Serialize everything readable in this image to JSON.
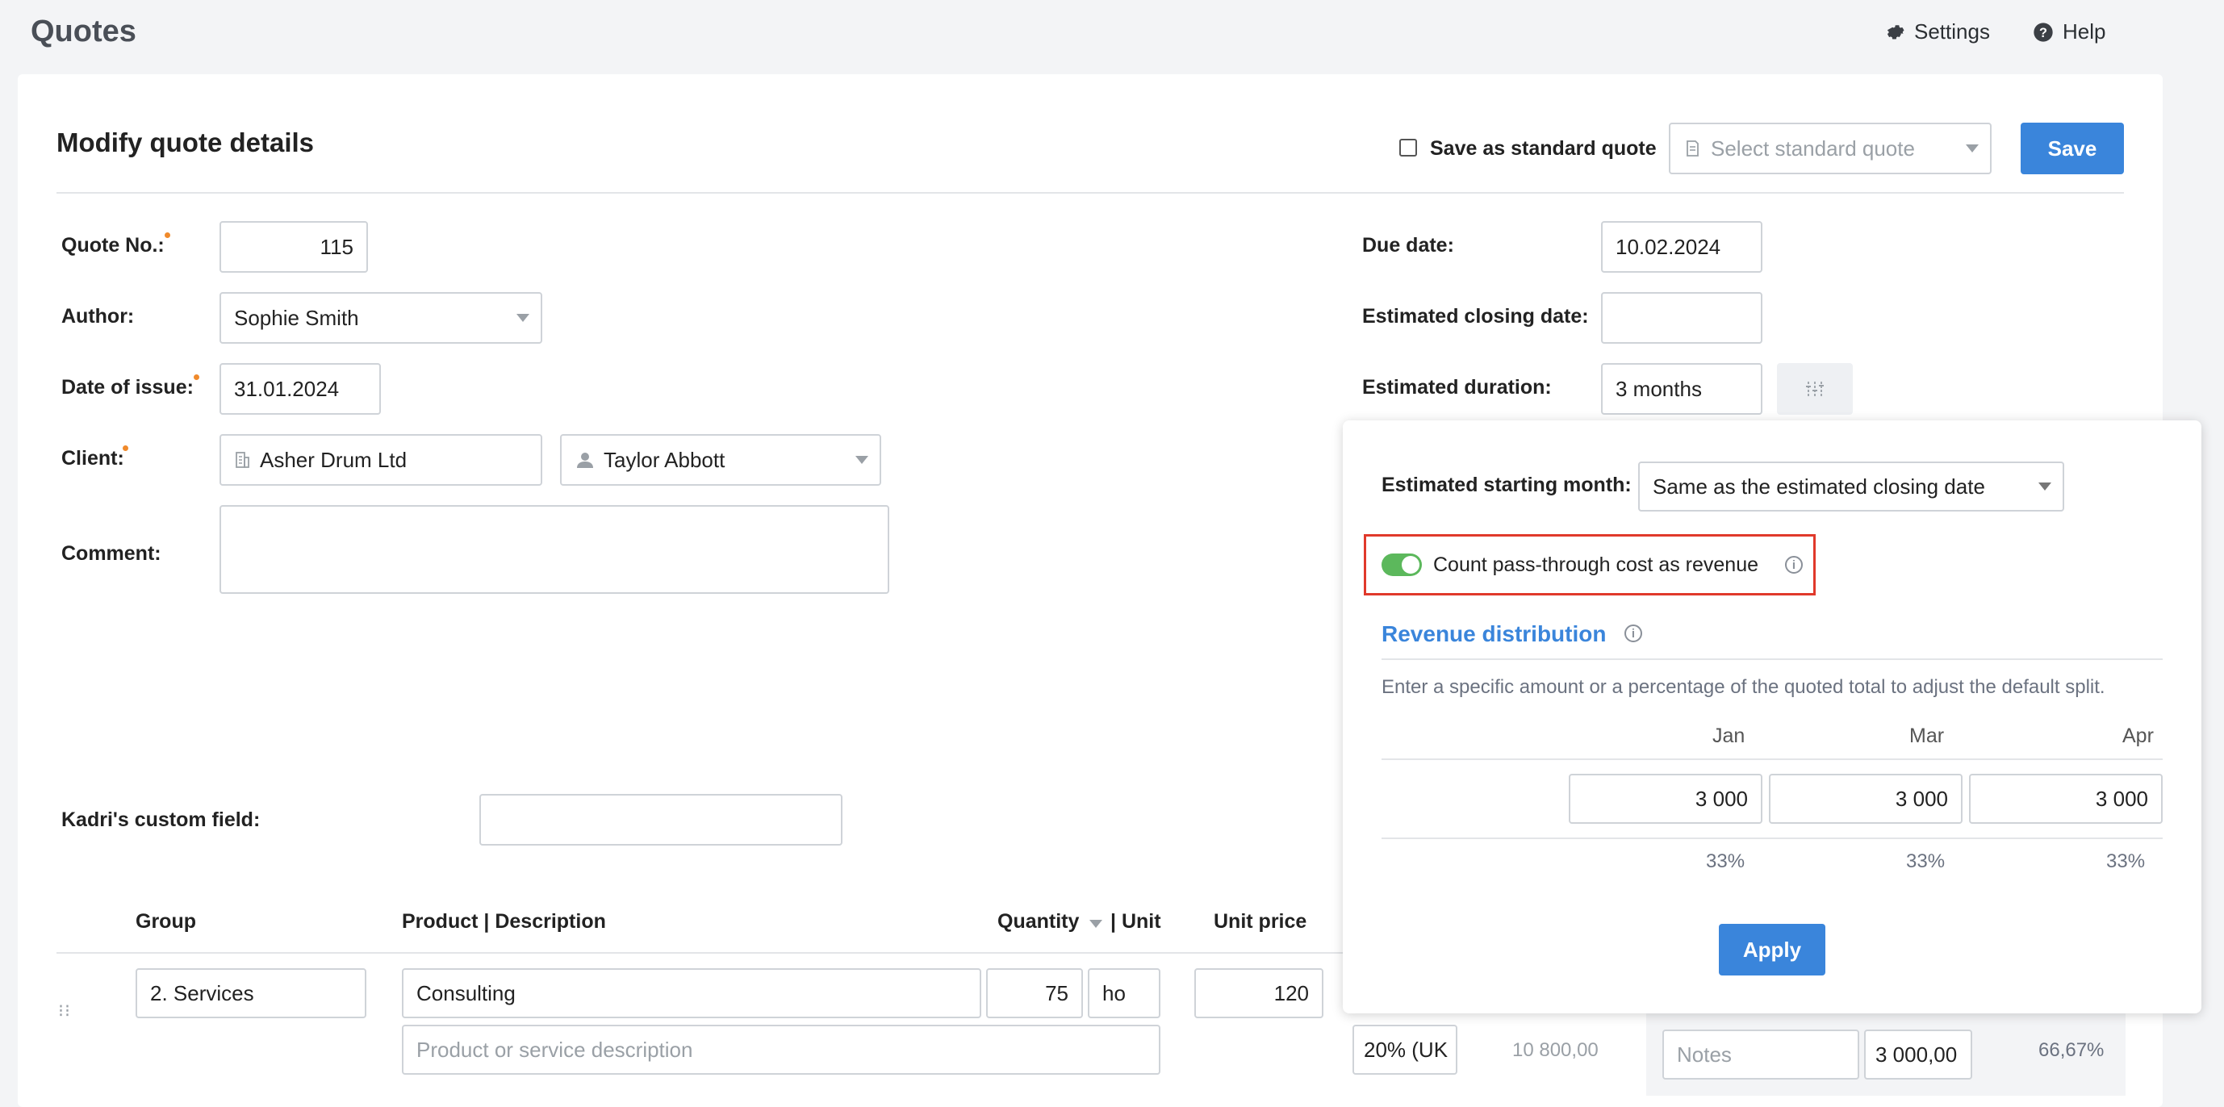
{
  "header": {
    "title": "Quotes",
    "settings_label": "Settings",
    "help_label": "Help"
  },
  "form": {
    "title": "Modify quote details",
    "save_standard_label": "Save as standard quote",
    "select_standard_placeholder": "Select standard quote",
    "save_label": "Save",
    "quote_no_label": "Quote No.:",
    "quote_no_value": "115",
    "author_label": "Author:",
    "author_value": "Sophie Smith",
    "date_issue_label": "Date of issue:",
    "date_issue_value": "31.01.2024",
    "client_label": "Client:",
    "client_company": "Asher Drum Ltd",
    "client_contact": "Taylor Abbott",
    "comment_label": "Comment:",
    "comment_value": "",
    "due_date_label": "Due date:",
    "due_date_value": "10.02.2024",
    "est_closing_label": "Estimated closing date:",
    "est_closing_value": "",
    "est_duration_label": "Estimated duration:",
    "est_duration_value": "3 months",
    "custom_field_label": "Kadri's custom field:",
    "custom_field_value": ""
  },
  "table": {
    "headers": {
      "group": "Group",
      "product": "Product | Description",
      "quantity": "Quantity",
      "unit": "| Unit",
      "unit_price": "Unit price"
    },
    "row": {
      "group": "2. Services",
      "product": "Consulting",
      "description_placeholder": "Product or service description",
      "quantity": "75",
      "unit": "ho",
      "unit_price": "120",
      "vat": "20% (UK",
      "total": "10 800,00",
      "notes_placeholder": "Notes",
      "amount": "3 000,00",
      "share": "66,67%"
    }
  },
  "popup": {
    "start_month_label": "Estimated starting month:",
    "start_month_value": "Same as the estimated closing date",
    "toggle_label": "Count pass-through cost as revenue",
    "toggle_on": true,
    "revenue_title": "Revenue distribution",
    "hint": "Enter a specific amount or a percentage of the quoted total to adjust the default split.",
    "months": [
      "Jan",
      "Mar",
      "Apr"
    ],
    "amounts": [
      "3 000",
      "3 000",
      "3 000"
    ],
    "percents": [
      "33%",
      "33%",
      "33%"
    ],
    "apply_label": "Apply"
  },
  "colors": {
    "accent": "#3a85db",
    "toggle": "#5cb85c",
    "highlight": "#e0392b",
    "required": "#f08a2b"
  }
}
